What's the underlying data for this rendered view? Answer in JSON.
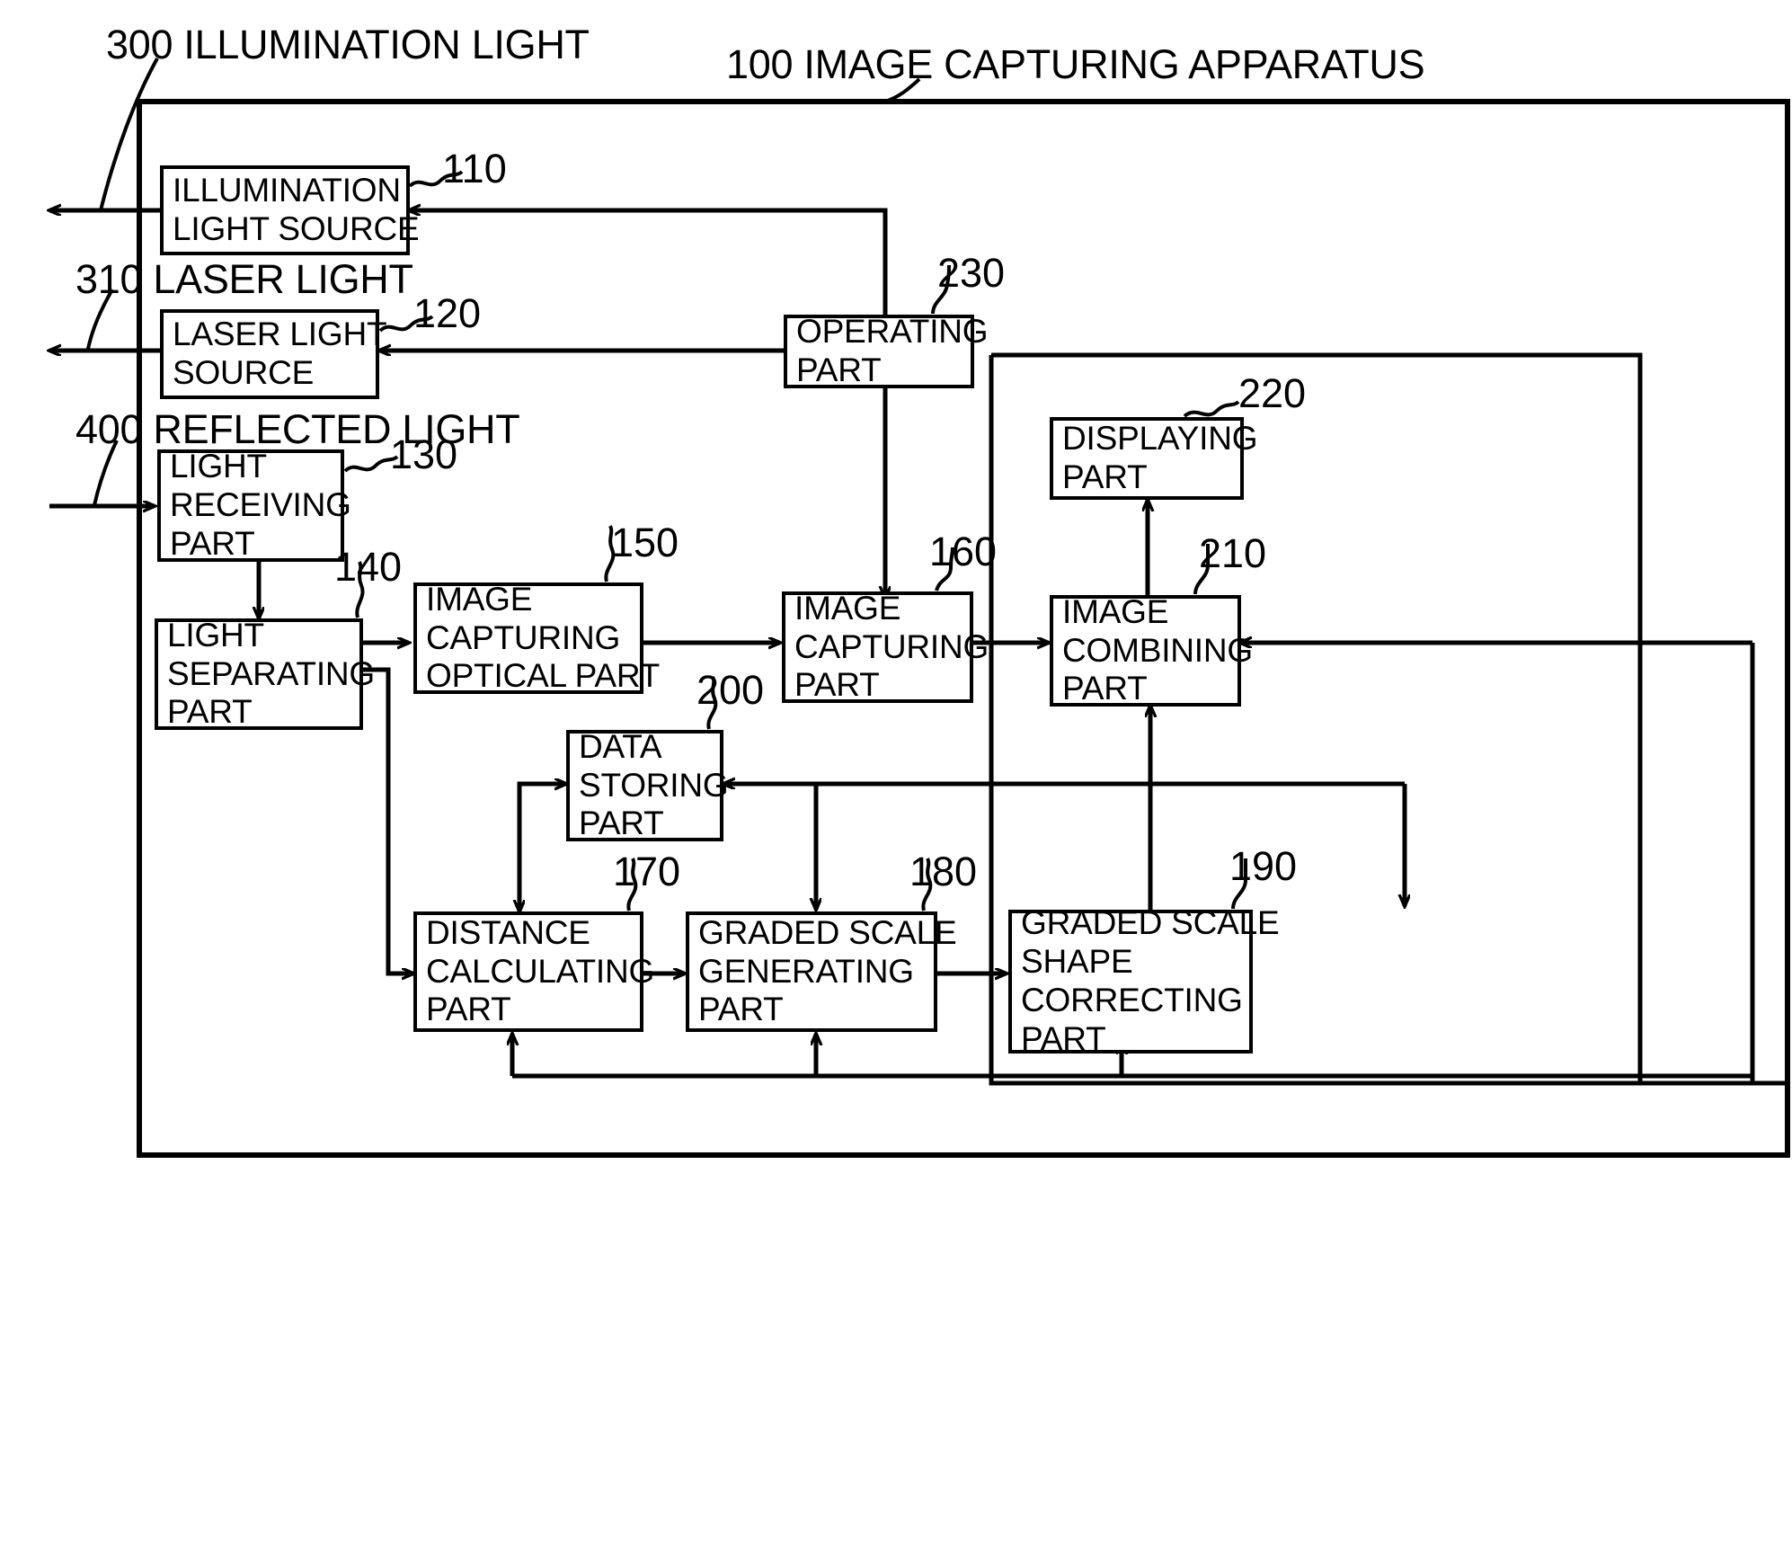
{
  "diagram": {
    "title_top_right": "100 IMAGE CAPTURING APPARATUS",
    "external_labels": [
      {
        "id": "illumination-light",
        "text": "300 ILLUMINATION LIGHT"
      },
      {
        "id": "laser-light",
        "text": "310 LASER LIGHT"
      },
      {
        "id": "reflected-light",
        "text": "400 REFLECTED LIGHT"
      }
    ],
    "blocks": [
      {
        "id": "illumination-light-source",
        "ref": "110",
        "lines": [
          "ILLUMINATION",
          "LIGHT SOURCE"
        ]
      },
      {
        "id": "laser-light-source",
        "ref": "120",
        "lines": [
          "LASER LIGHT",
          "SOURCE"
        ]
      },
      {
        "id": "light-receiving-part",
        "ref": "130",
        "lines": [
          "LIGHT",
          "RECEIVING",
          "PART"
        ]
      },
      {
        "id": "light-separating-part",
        "ref": "140",
        "lines": [
          "LIGHT",
          "SEPARATING",
          "PART"
        ]
      },
      {
        "id": "image-capturing-optical-part",
        "ref": "150",
        "lines": [
          "IMAGE",
          "CAPTURING",
          "OPTICAL PART"
        ]
      },
      {
        "id": "image-capturing-part",
        "ref": "160",
        "lines": [
          "IMAGE",
          "CAPTURING",
          "PART"
        ]
      },
      {
        "id": "distance-calculating-part",
        "ref": "170",
        "lines": [
          "DISTANCE",
          "CALCULATING",
          "PART"
        ]
      },
      {
        "id": "graded-scale-generating-part",
        "ref": "180",
        "lines": [
          "GRADED SCALE",
          "GENERATING",
          "PART"
        ]
      },
      {
        "id": "graded-scale-shape-correcting-part",
        "ref": "190",
        "lines": [
          "GRADED SCALE",
          "SHAPE",
          "CORRECTING",
          "PART"
        ]
      },
      {
        "id": "data-storing-part",
        "ref": "200",
        "lines": [
          "DATA",
          "STORING",
          "PART"
        ]
      },
      {
        "id": "image-combining-part",
        "ref": "210",
        "lines": [
          "IMAGE",
          "COMBINING",
          "PART"
        ]
      },
      {
        "id": "displaying-part",
        "ref": "220",
        "lines": [
          "DISPLAYING",
          "PART"
        ]
      },
      {
        "id": "operating-part",
        "ref": "230",
        "lines": [
          "OPERATING",
          "PART"
        ]
      }
    ],
    "ref_numbers": [
      "100",
      "110",
      "120",
      "130",
      "140",
      "150",
      "160",
      "170",
      "180",
      "190",
      "200",
      "210",
      "220",
      "230",
      "300",
      "310",
      "400"
    ],
    "colors": {
      "stroke": "#000000",
      "background": "#ffffff"
    }
  }
}
